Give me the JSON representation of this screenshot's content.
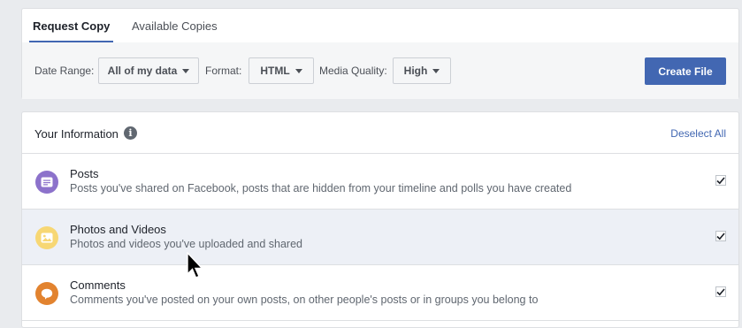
{
  "tabs": [
    {
      "label": "Request Copy",
      "active": true
    },
    {
      "label": "Available Copies",
      "active": false
    }
  ],
  "filters": {
    "date_range": {
      "label": "Date Range:",
      "value": "All of my data"
    },
    "format": {
      "label": "Format:",
      "value": "HTML"
    },
    "media_quality": {
      "label": "Media Quality:",
      "value": "High"
    },
    "create_button": "Create File"
  },
  "info": {
    "title": "Your Information",
    "info_icon": "i",
    "deselect_all": "Deselect All",
    "categories": [
      {
        "title": "Posts",
        "description": "Posts you've shared on Facebook, posts that are hidden from your timeline and polls you have created",
        "icon": "posts-icon",
        "color": "#8c72cb",
        "checked": true
      },
      {
        "title": "Photos and Videos",
        "description": "Photos and videos you've uploaded and shared",
        "icon": "photos-icon",
        "color": "#f7d774",
        "checked": true
      },
      {
        "title": "Comments",
        "description": "Comments you've posted on your own posts, on other people's posts or in groups you belong to",
        "icon": "comments-icon",
        "color": "#e2832f",
        "checked": true
      }
    ]
  },
  "colors": {
    "accent": "#4267b2",
    "highlight_row": "#edf0f6"
  }
}
